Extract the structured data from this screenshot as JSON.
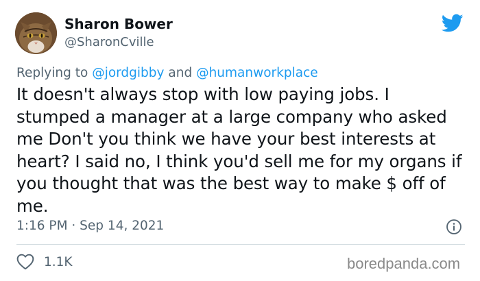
{
  "author": {
    "display_name": "Sharon Bower",
    "handle": "@SharonCville"
  },
  "reply": {
    "prefix": "Replying to ",
    "mention_1": "@jordgibby",
    "joiner": " and ",
    "mention_2": "@humanworkplace"
  },
  "tweet": {
    "text": "It doesn't always stop with low paying jobs. I stumped a manager at a large company who asked me Don't you think we have your best interests at heart? I said no, I think you'd sell me for my organs if you thought that was the best way to make $ off of me.",
    "timestamp": "1:16 PM · Sep 14, 2021",
    "likes": "1.1K"
  },
  "watermark": "boredpanda.com",
  "colors": {
    "twitter_blue": "#1d9bf0",
    "secondary_text": "#536471"
  },
  "icons": {
    "brand": "twitter-bird-icon",
    "info": "info-icon",
    "like": "heart-icon"
  }
}
